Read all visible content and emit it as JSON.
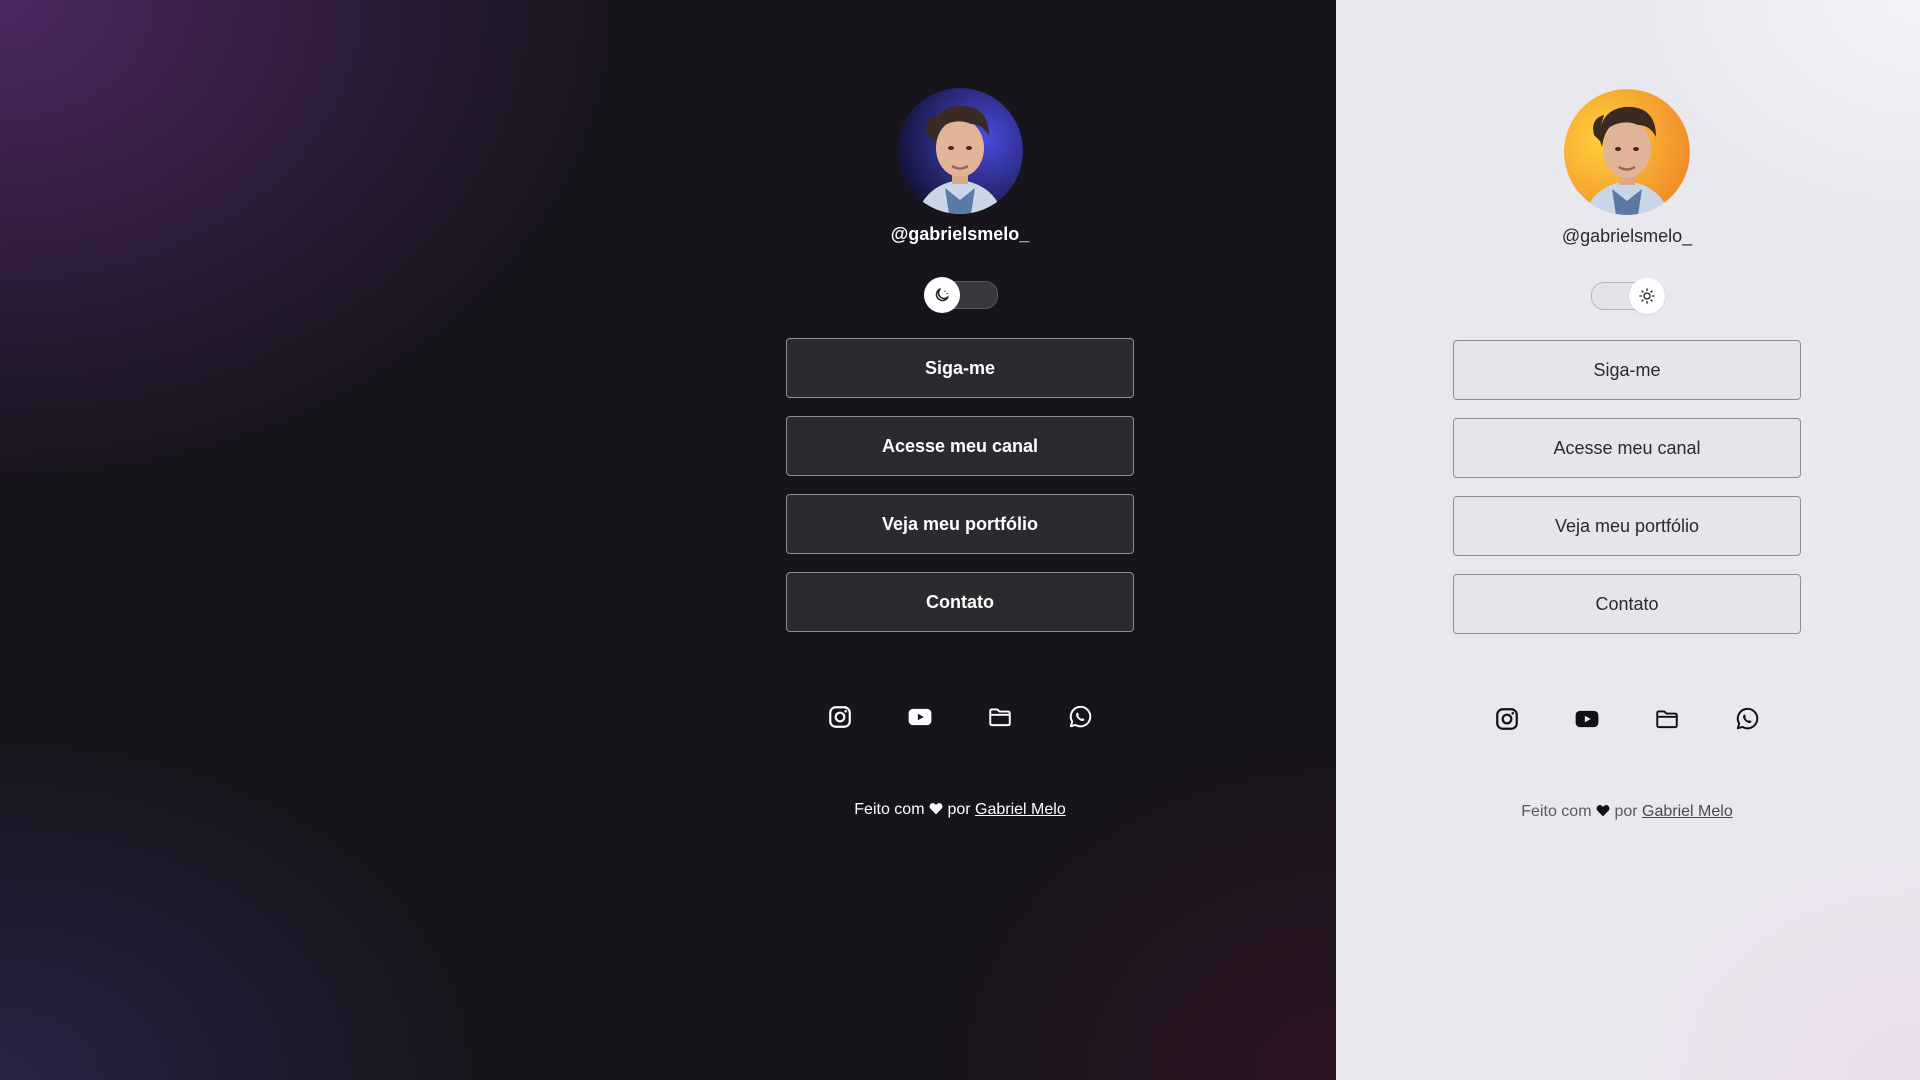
{
  "colors": {
    "dark_bg": "#17141b",
    "dark_button": "#2b2a2e",
    "light_bg": "#e9e8ee",
    "light_button": "#e6e5ea",
    "avatar_dark_ring": "#3838c8",
    "avatar_light_ring": "#f4b32a"
  },
  "dark": {
    "handle": "@gabrielsmelo_",
    "theme_toggle": {
      "state": "dark",
      "icon": "moon-icon"
    },
    "buttons": [
      "Siga-me",
      "Acesse meu canal",
      "Veja meu portfólio",
      "Contato"
    ],
    "socials": [
      "instagram-icon",
      "youtube-icon",
      "folder-icon",
      "whatsapp-icon"
    ],
    "footer": {
      "prefix": "Feito com",
      "middle": "por",
      "author": "Gabriel Melo"
    }
  },
  "light": {
    "handle": "@gabrielsmelo_",
    "theme_toggle": {
      "state": "light",
      "icon": "sun-icon"
    },
    "buttons": [
      "Siga-me",
      "Acesse meu canal",
      "Veja meu portfólio",
      "Contato"
    ],
    "socials": [
      "instagram-icon",
      "youtube-icon",
      "folder-icon",
      "whatsapp-icon"
    ],
    "footer": {
      "prefix": "Feito com",
      "middle": "por",
      "author": "Gabriel Melo"
    }
  }
}
